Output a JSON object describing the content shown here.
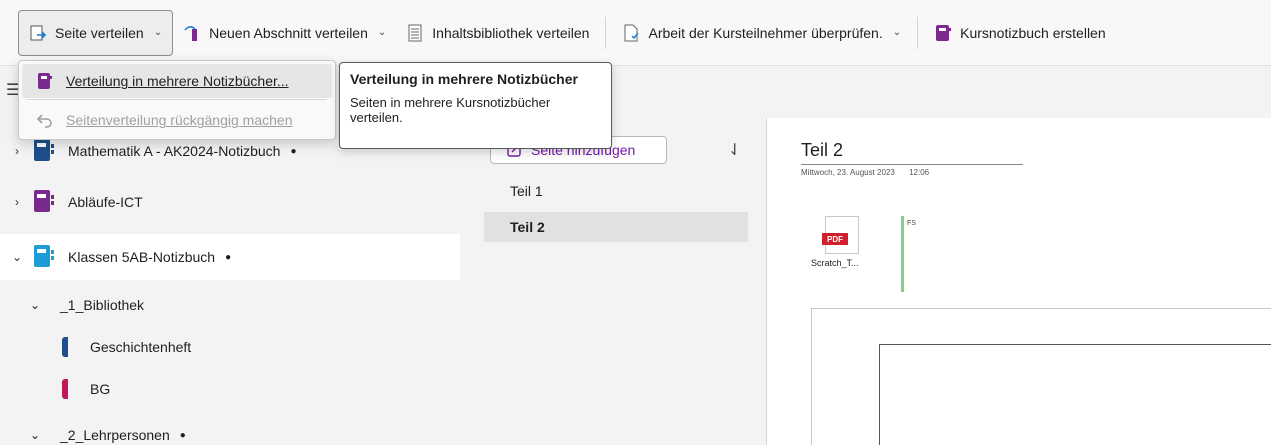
{
  "ribbon": {
    "buttons": [
      {
        "label": "Seite verteilen",
        "icon": "distribute-page-icon",
        "chevron": true
      },
      {
        "label": "Neuen Abschnitt verteilen",
        "icon": "distribute-section-icon",
        "chevron": true
      },
      {
        "label": "Inhaltsbibliothek verteilen",
        "icon": "content-library-icon",
        "chevron": false
      },
      {
        "label": "Arbeit der Kursteilnehmer überprüfen.",
        "icon": "review-work-icon",
        "chevron": true
      },
      {
        "label": "Kursnotizbuch erstellen",
        "icon": "class-notebook-icon",
        "chevron": false
      }
    ]
  },
  "dropdown": {
    "items": [
      {
        "label": "Verteilung in mehrere Notizbücher...",
        "icon": "notebook-icon",
        "enabled": true
      },
      {
        "label": "Seitenverteilung rückgängig machen",
        "icon": "undo-icon",
        "enabled": false
      }
    ]
  },
  "tooltip": {
    "title": "Verteilung in mehrere Notizbücher",
    "body": "Seiten in mehrere Kursnotizbücher verteilen."
  },
  "sidebar": {
    "notebooks": [
      {
        "label": "Mathematik A - AK2024-Notizbuch",
        "color": "#1e4e8c",
        "dot": "●",
        "expanded": false
      },
      {
        "label": "Abläufe-ICT",
        "color": "#7a2a8c",
        "dot": "",
        "expanded": false
      },
      {
        "label": "Klassen 5AB-Notizbuch",
        "color": "#1f9bd6",
        "dot": "●",
        "expanded": true
      }
    ],
    "groups": [
      {
        "label": "_1_Bibliothek",
        "dot": ""
      },
      {
        "label": "_2_Lehrpersonen",
        "dot": "●"
      }
    ],
    "sections": [
      {
        "label": "Geschichtenheft",
        "color": "#1e4e8c"
      },
      {
        "label": "BG",
        "color": "#c2185b"
      }
    ]
  },
  "pages": {
    "add_label": "Seite hinzufügen",
    "items": [
      {
        "label": "Teil 1",
        "selected": false
      },
      {
        "label": "Teil 2",
        "selected": true
      }
    ]
  },
  "canvas": {
    "title": "Teil 2",
    "date": "Mittwoch, 23. August 2023",
    "time": "12:06",
    "attachment": {
      "badge": "PDF",
      "name": "Scratch_T..."
    },
    "ink_label": "FS"
  }
}
